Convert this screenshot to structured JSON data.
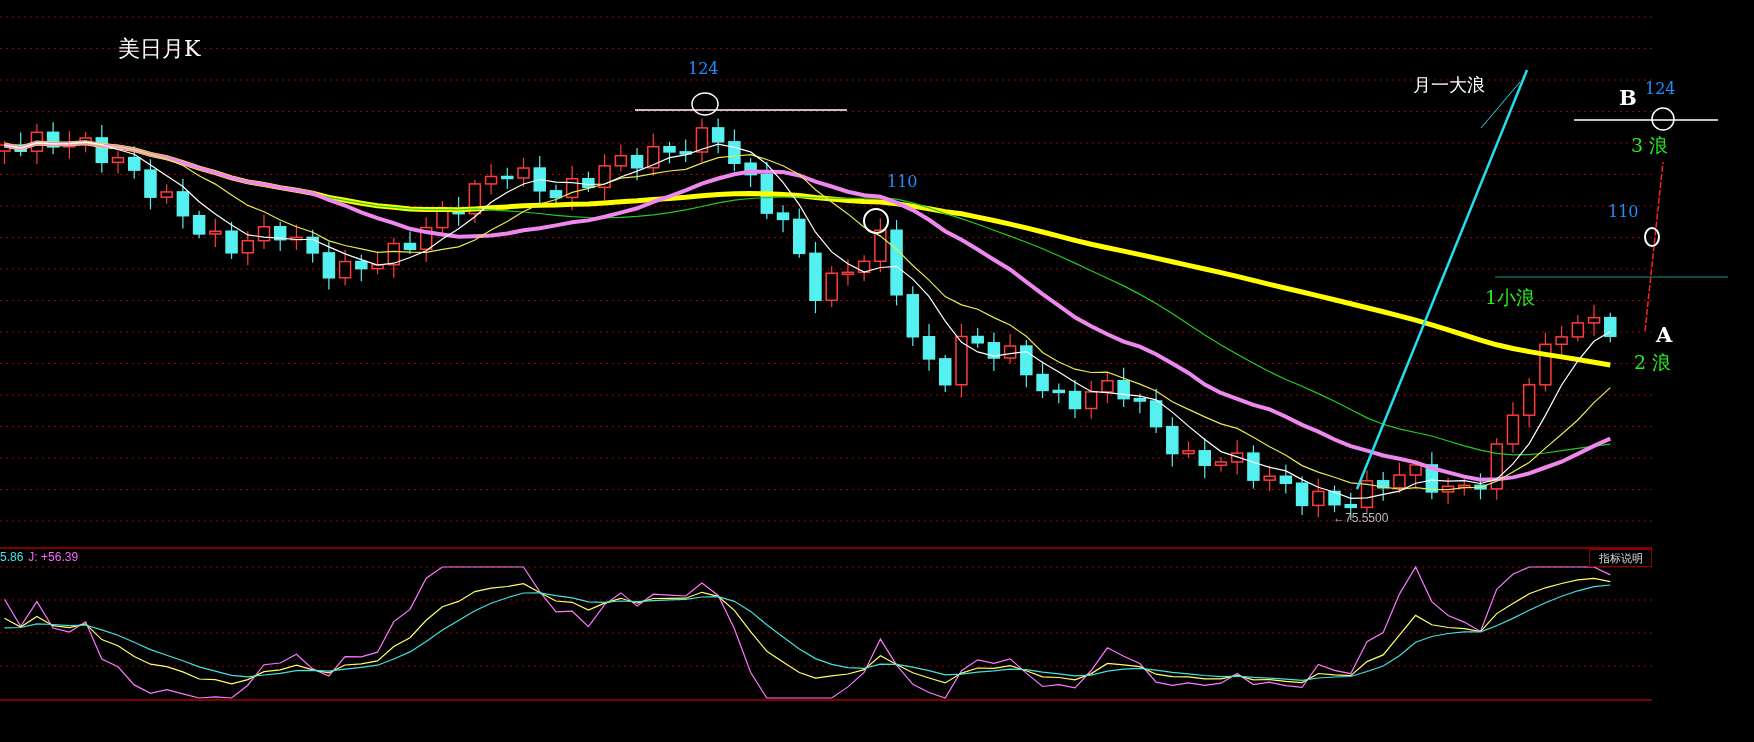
{
  "chart_title": "美日月K",
  "annotations": [
    {
      "text": "124",
      "kind": "level"
    },
    {
      "text": "110",
      "kind": "level"
    },
    {
      "text": "月一大浪",
      "kind": "note"
    },
    {
      "text": "B",
      "kind": "point"
    },
    {
      "text": "124",
      "kind": "level"
    },
    {
      "text": "3 浪",
      "kind": "wave"
    },
    {
      "text": "110",
      "kind": "level"
    },
    {
      "text": "1小浪",
      "kind": "wave"
    },
    {
      "text": "A",
      "kind": "point"
    },
    {
      "text": "2 浪",
      "kind": "wave"
    }
  ],
  "low_marker": {
    "text": "←75.5500"
  },
  "indicator_readout": [
    {
      "text": "5.86",
      "color": "#44e8e8"
    },
    {
      "text": "J: +56.39",
      "color": "#ff66ff"
    }
  ],
  "indicator_button": {
    "label": "指标说明"
  }
}
